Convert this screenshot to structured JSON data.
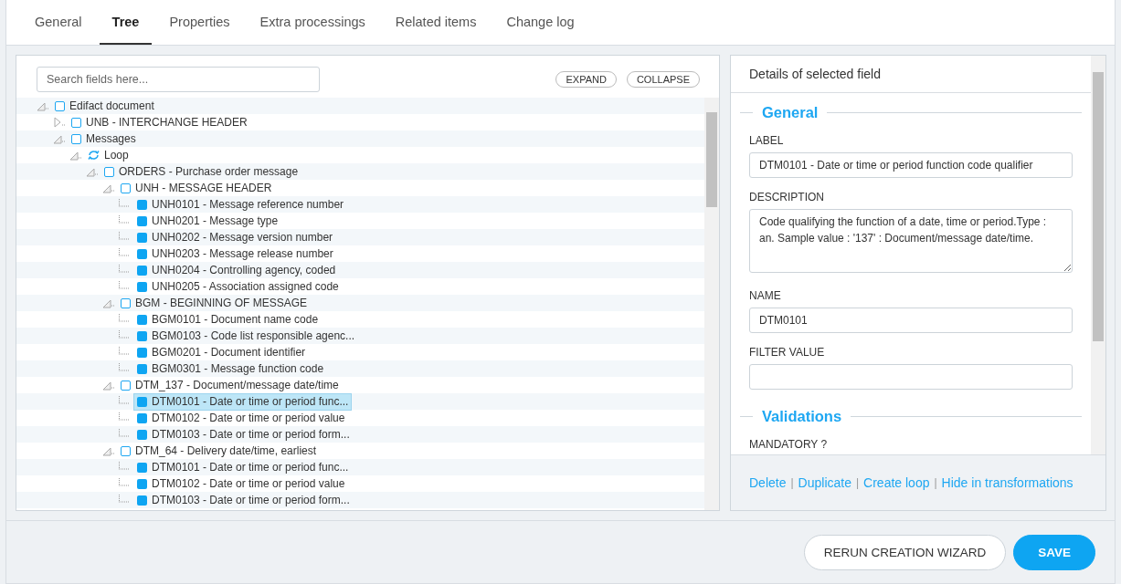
{
  "tabs": [
    {
      "label": "General",
      "selected": false
    },
    {
      "label": "Tree",
      "selected": true
    },
    {
      "label": "Properties",
      "selected": false
    },
    {
      "label": "Extra processings",
      "selected": false
    },
    {
      "label": "Related items",
      "selected": false
    },
    {
      "label": "Change log",
      "selected": false
    }
  ],
  "tree_panel": {
    "search": {
      "placeholder": "Search fields here..."
    },
    "buttons": [
      "EXPAND",
      "COLLAPSE"
    ],
    "tree": [
      {
        "label": "Edifact document",
        "kind": "segment",
        "expanded": true,
        "selected": false,
        "children": [
          {
            "label": "UNB - INTERCHANGE HEADER",
            "kind": "segment",
            "expanded": false,
            "selected": false
          },
          {
            "label": "Messages",
            "kind": "segment",
            "expanded": true,
            "selected": false,
            "children": [
              {
                "label": "Loop",
                "kind": "loop",
                "expanded": true,
                "selected": false,
                "children": [
                  {
                    "label": "ORDERS - Purchase order message",
                    "kind": "segment",
                    "expanded": true,
                    "selected": false,
                    "children": [
                      {
                        "label": "UNH - MESSAGE HEADER",
                        "kind": "segment",
                        "expanded": true,
                        "selected": false,
                        "children": [
                          {
                            "label": "UNH0101 - Message reference number",
                            "kind": "field",
                            "selected": false
                          },
                          {
                            "label": "UNH0201 - Message type",
                            "kind": "field",
                            "selected": false
                          },
                          {
                            "label": "UNH0202 - Message version number",
                            "kind": "field",
                            "selected": false
                          },
                          {
                            "label": "UNH0203 - Message release number",
                            "kind": "field",
                            "selected": false
                          },
                          {
                            "label": "UNH0204 - Controlling agency, coded",
                            "kind": "field",
                            "selected": false
                          },
                          {
                            "label": "UNH0205 - Association assigned code",
                            "kind": "field",
                            "selected": false
                          }
                        ]
                      },
                      {
                        "label": "BGM - BEGINNING OF MESSAGE",
                        "kind": "segment",
                        "expanded": true,
                        "selected": false,
                        "children": [
                          {
                            "label": "BGM0101 - Document name code",
                            "kind": "field",
                            "selected": false
                          },
                          {
                            "label": "BGM0103 - Code list responsible agenc...",
                            "kind": "field",
                            "selected": false
                          },
                          {
                            "label": "BGM0201 - Document identifier",
                            "kind": "field",
                            "selected": false
                          },
                          {
                            "label": "BGM0301 - Message function code",
                            "kind": "field",
                            "selected": false
                          }
                        ]
                      },
                      {
                        "label": "DTM_137 - Document/message date/time",
                        "kind": "segment",
                        "expanded": true,
                        "selected": false,
                        "children": [
                          {
                            "label": "DTM0101 - Date or time or period func...",
                            "kind": "field",
                            "selected": true
                          },
                          {
                            "label": "DTM0102 - Date or time or period value",
                            "kind": "field",
                            "selected": false
                          },
                          {
                            "label": "DTM0103 - Date or time or period form...",
                            "kind": "field",
                            "selected": false
                          }
                        ]
                      },
                      {
                        "label": "DTM_64 - Delivery date/time, earliest",
                        "kind": "segment",
                        "expanded": true,
                        "selected": false,
                        "children": [
                          {
                            "label": "DTM0101 - Date or time or period func...",
                            "kind": "field",
                            "selected": false
                          },
                          {
                            "label": "DTM0102 - Date or time or period value",
                            "kind": "field",
                            "selected": false
                          },
                          {
                            "label": "DTM0103 - Date or time or period form...",
                            "kind": "field",
                            "selected": false
                          }
                        ]
                      }
                    ]
                  }
                ]
              }
            ]
          }
        ]
      }
    ]
  },
  "details": {
    "title": "Details of selected field",
    "sections": [
      {
        "title": "General",
        "fields": [
          {
            "label": "LABEL",
            "kind": "input",
            "value": "DTM0101 - Date or time or period function code qualifier"
          },
          {
            "label": "DESCRIPTION",
            "kind": "textarea",
            "value": "Code qualifying the function of a date, time or period.Type : an. Sample value : '137' : Document/message date/time."
          },
          {
            "label": "NAME",
            "kind": "input",
            "value": "DTM0101"
          },
          {
            "label": "FILTER VALUE",
            "kind": "input"
          }
        ]
      },
      {
        "title": "Validations",
        "fields": [
          {
            "label": "MANDATORY ?",
            "kind": "none"
          }
        ]
      }
    ],
    "links": [
      "Delete",
      "Duplicate",
      "Create loop",
      "Hide in transformations"
    ],
    "separator": "|"
  },
  "footer": {
    "buttons": [
      {
        "label": "RERUN CREATION WIZARD",
        "kind": "secondary"
      },
      {
        "label": "SAVE",
        "kind": "primary"
      }
    ]
  }
}
